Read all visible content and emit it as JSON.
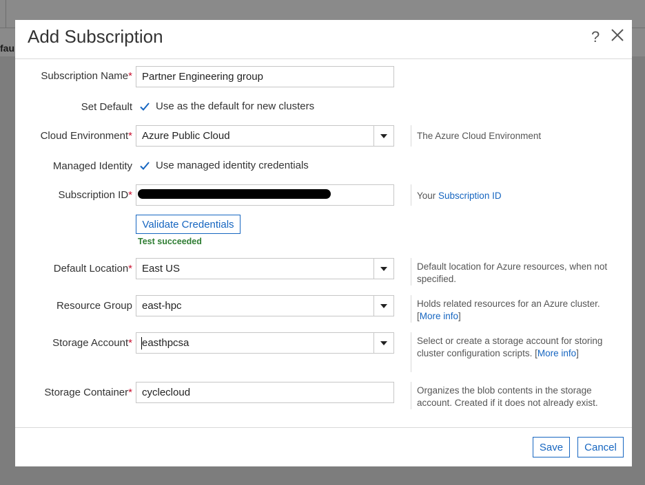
{
  "background": {
    "fragment": "fau"
  },
  "dialog": {
    "title": "Add Subscription",
    "help_icon": "?",
    "close_icon": "close-icon"
  },
  "fields": {
    "subscription_name": {
      "label": "Subscription Name",
      "required": "*",
      "value": "Partner Engineering group"
    },
    "set_default": {
      "label": "Set Default",
      "checkbox_label": "Use as the default for new clusters",
      "checked": true
    },
    "cloud_environment": {
      "label": "Cloud Environment",
      "required": "*",
      "value": "Azure Public Cloud",
      "hint": "The Azure Cloud Environment"
    },
    "managed_identity": {
      "label": "Managed Identity",
      "checkbox_label": "Use managed identity credentials",
      "checked": true
    },
    "subscription_id": {
      "label": "Subscription ID",
      "required": "*",
      "hint_prefix": "Your ",
      "hint_link": "Subscription ID"
    },
    "validate": {
      "button_label": "Validate Credentials",
      "status": "Test succeeded"
    },
    "default_location": {
      "label": "Default Location",
      "required": "*",
      "value": "East US",
      "hint": "Default location for Azure resources, when not specified."
    },
    "resource_group": {
      "label": "Resource Group",
      "value": "east-hpc",
      "hint": "Holds related resources for an Azure cluster. ",
      "hint_link_open": "[",
      "hint_link": "More info",
      "hint_link_close": "]"
    },
    "storage_account": {
      "label": "Storage Account",
      "required": "*",
      "value": "easthpcsa",
      "hint": "Select or create a storage account for storing cluster configuration scripts. ",
      "hint_link_open": "[",
      "hint_link": "More info",
      "hint_link_close": "]"
    },
    "storage_container": {
      "label": "Storage Container",
      "required": "*",
      "value": "cyclecloud",
      "hint": "Organizes the blob contents in the storage account. Created if it does not already exist."
    }
  },
  "footer": {
    "save_label": "Save",
    "cancel_label": "Cancel"
  },
  "colors": {
    "accent": "#1565c0",
    "required": "#c8102e",
    "success": "#2e7d32"
  }
}
